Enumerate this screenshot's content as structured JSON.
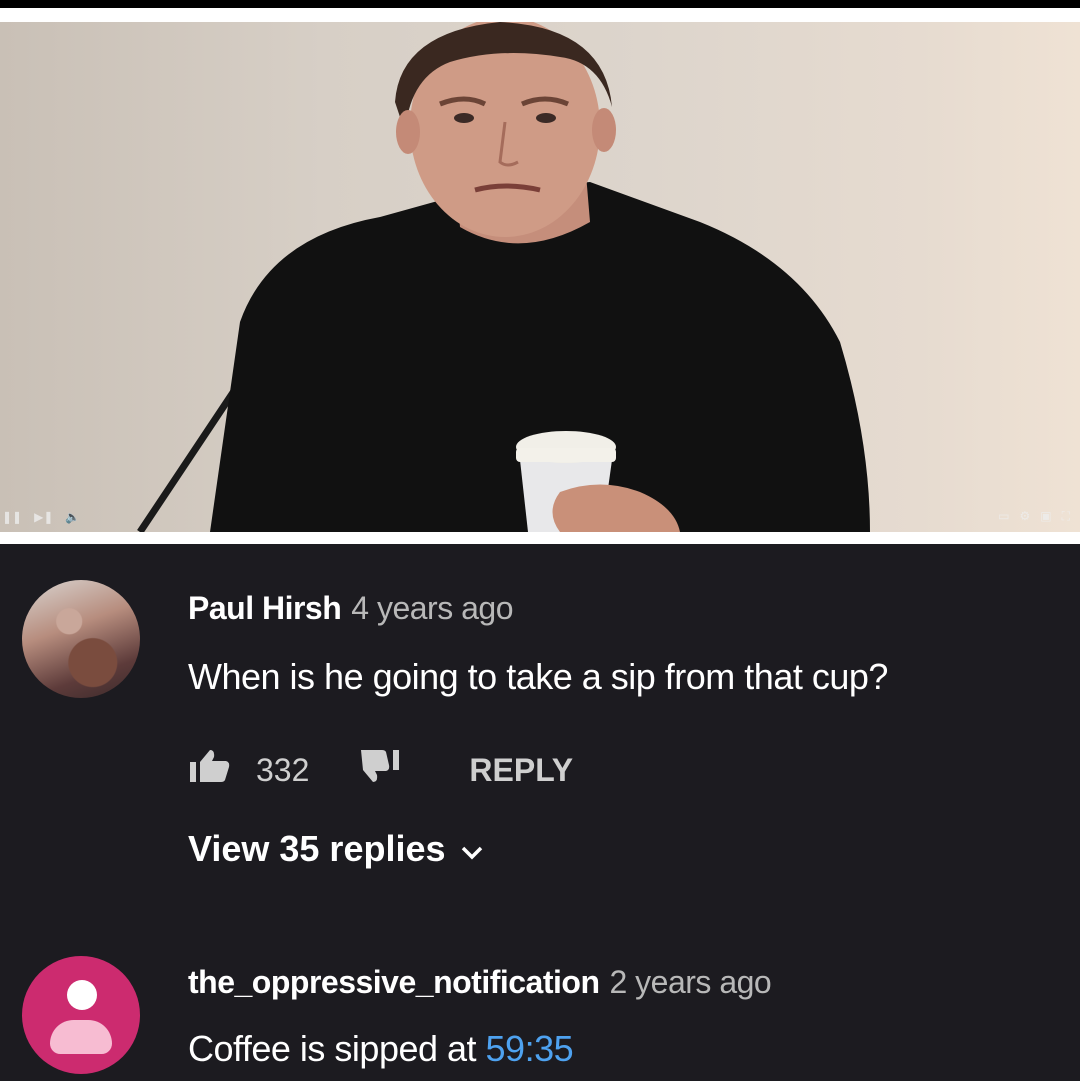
{
  "video": {
    "controls_left": [
      "❚❚",
      "▶❚",
      "🔈"
    ],
    "controls_right": [
      "▭",
      "⚙",
      "▣",
      "⛶"
    ]
  },
  "comments": [
    {
      "author": "Paul Hirsh",
      "time": "4 years ago",
      "text": "When is he going to take a sip from that cup?",
      "likes": "332",
      "reply_label": "REPLY",
      "view_replies": "View 35 replies"
    },
    {
      "author": "the_oppressive_notification",
      "time": "2 years ago",
      "text": "Coffee is sipped at ",
      "timestamp": "59:35"
    }
  ],
  "colors": {
    "background": "#1c1b20",
    "timestamp_link": "#4ea2f0",
    "default_avatar": "#cc2b6f"
  },
  "icons": [
    "thumbs-up-icon",
    "thumbs-down-icon",
    "chevron-down-icon",
    "person-icon"
  ]
}
